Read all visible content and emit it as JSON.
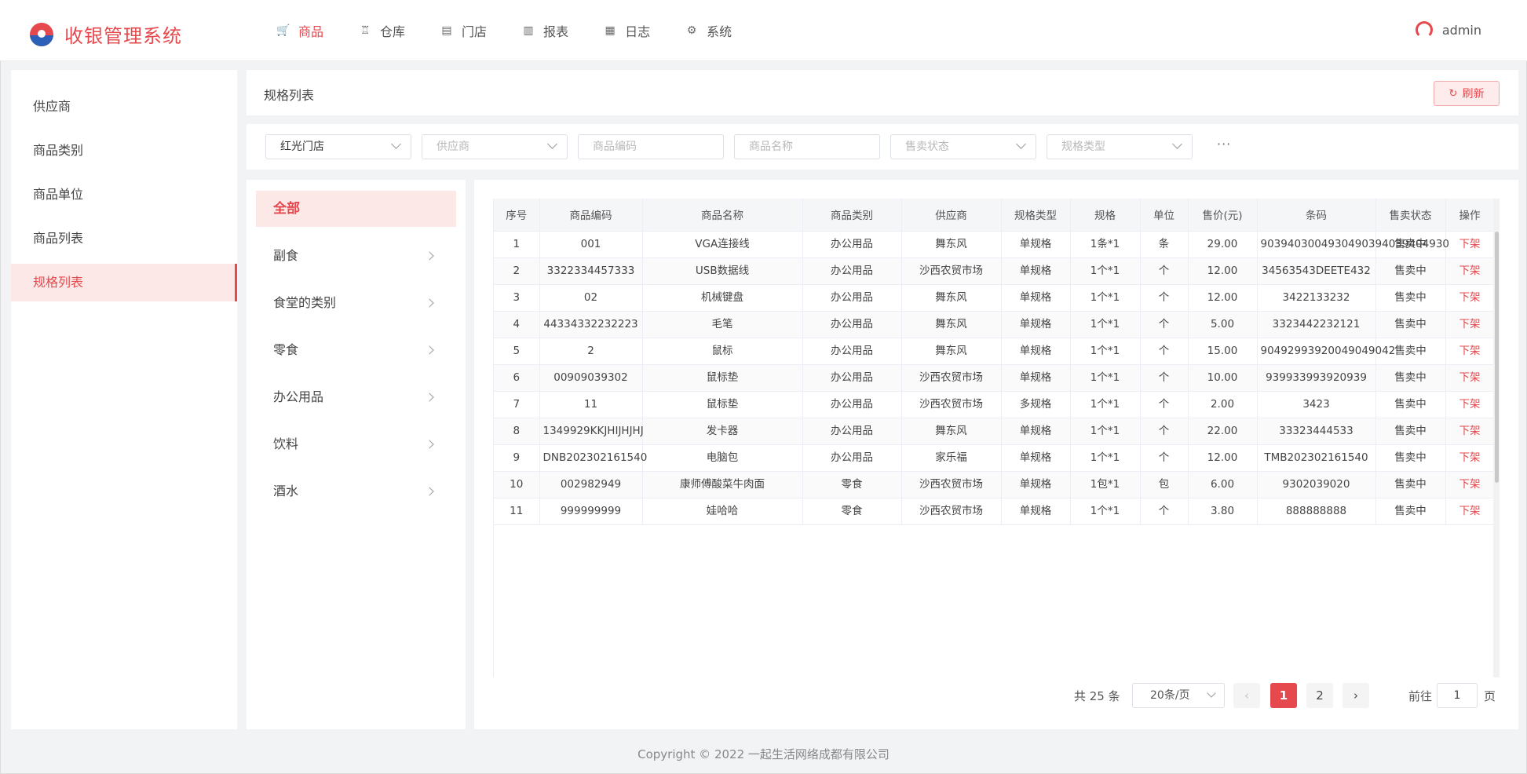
{
  "app": {
    "title": "收银管理系统",
    "user": "admin"
  },
  "nav": [
    {
      "label": "商品",
      "icon": "cart-icon",
      "glyph": "🛒",
      "active": true
    },
    {
      "label": "仓库",
      "icon": "warehouse-icon",
      "glyph": "♖",
      "active": false
    },
    {
      "label": "门店",
      "icon": "store-icon",
      "glyph": "▤",
      "active": false
    },
    {
      "label": "报表",
      "icon": "chart-icon",
      "glyph": "▥",
      "active": false
    },
    {
      "label": "日志",
      "icon": "log-icon",
      "glyph": "▦",
      "active": false
    },
    {
      "label": "系统",
      "icon": "gear-icon",
      "glyph": "⚙",
      "active": false
    }
  ],
  "sidebar": {
    "items": [
      {
        "label": "供应商",
        "active": false
      },
      {
        "label": "商品类别",
        "active": false
      },
      {
        "label": "商品单位",
        "active": false
      },
      {
        "label": "商品列表",
        "active": false
      },
      {
        "label": "规格列表",
        "active": true
      }
    ]
  },
  "titlebar": {
    "title": "规格列表",
    "refresh_label": "刷新",
    "refresh_icon": "refresh-icon"
  },
  "filters": {
    "store": "红光门店",
    "supplier_placeholder": "供应商",
    "code_placeholder": "商品编码",
    "name_placeholder": "商品名称",
    "status_placeholder": "售卖状态",
    "spec_type_placeholder": "规格类型",
    "more": "···"
  },
  "categories": {
    "all": "全部",
    "items": [
      "副食",
      "食堂的类别",
      "零食",
      "办公用品",
      "饮料",
      "酒水"
    ]
  },
  "table": {
    "columns": [
      "序号",
      "商品编码",
      "商品名称",
      "商品类别",
      "供应商",
      "规格类型",
      "规格",
      "单位",
      "售价(元)",
      "条码",
      "售卖状态",
      "操作"
    ],
    "rows": [
      [
        "1",
        "001",
        "VGA连接线",
        "办公用品",
        "舞东风",
        "单规格",
        "1条*1",
        "条",
        "29.00",
        "9039403004930490394039404930",
        "售卖中",
        "下架"
      ],
      [
        "2",
        "3322334457333",
        "USB数据线",
        "办公用品",
        "沙西农贸市场",
        "单规格",
        "1个*1",
        "个",
        "12.00",
        "34563543DEETE432",
        "售卖中",
        "下架"
      ],
      [
        "3",
        "02",
        "机械键盘",
        "办公用品",
        "舞东风",
        "单规格",
        "1个*1",
        "个",
        "12.00",
        "3422133232",
        "售卖中",
        "下架"
      ],
      [
        "4",
        "44334332232223",
        "毛笔",
        "办公用品",
        "舞东风",
        "单规格",
        "1个*1",
        "个",
        "5.00",
        "3323442232121",
        "售卖中",
        "下架"
      ],
      [
        "5",
        "2",
        "鼠标",
        "办公用品",
        "舞东风",
        "单规格",
        "1个*1",
        "个",
        "15.00",
        "90492993920049049042",
        "售卖中",
        "下架"
      ],
      [
        "6",
        "00909039302",
        "鼠标垫",
        "办公用品",
        "沙西农贸市场",
        "单规格",
        "1个*1",
        "个",
        "10.00",
        "939933993920939",
        "售卖中",
        "下架"
      ],
      [
        "7",
        "11",
        "鼠标垫",
        "办公用品",
        "沙西农贸市场",
        "多规格",
        "1个*1",
        "个",
        "2.00",
        "3423",
        "售卖中",
        "下架"
      ],
      [
        "8",
        "1349929KKJHIJHJHJ",
        "发卡器",
        "办公用品",
        "舞东风",
        "单规格",
        "1个*1",
        "个",
        "22.00",
        "33323444533",
        "售卖中",
        "下架"
      ],
      [
        "9",
        "DNB202302161540",
        "电脑包",
        "办公用品",
        "家乐福",
        "单规格",
        "1个*1",
        "个",
        "12.00",
        "TMB202302161540",
        "售卖中",
        "下架"
      ],
      [
        "10",
        "002982949",
        "康师傅酸菜牛肉面",
        "零食",
        "沙西农贸市场",
        "单规格",
        "1包*1",
        "包",
        "6.00",
        "9302039020",
        "售卖中",
        "下架"
      ],
      [
        "11",
        "999999999",
        "娃哈哈",
        "零食",
        "沙西农贸市场",
        "单规格",
        "1个*1",
        "个",
        "3.80",
        "888888888",
        "售卖中",
        "下架"
      ]
    ]
  },
  "pagination": {
    "total": "共 25 条",
    "page_size": "20条/页",
    "prev": "‹",
    "pages": [
      "1",
      "2"
    ],
    "current": "1",
    "next": "›",
    "goto_prefix": "前往",
    "goto_value": "1",
    "goto_suffix": "页"
  },
  "footer": "Copyright © 2022 一起生活网络成都有限公司",
  "colors": {
    "accent": "#e5484d",
    "brand_blue": "#2c5fb8"
  }
}
